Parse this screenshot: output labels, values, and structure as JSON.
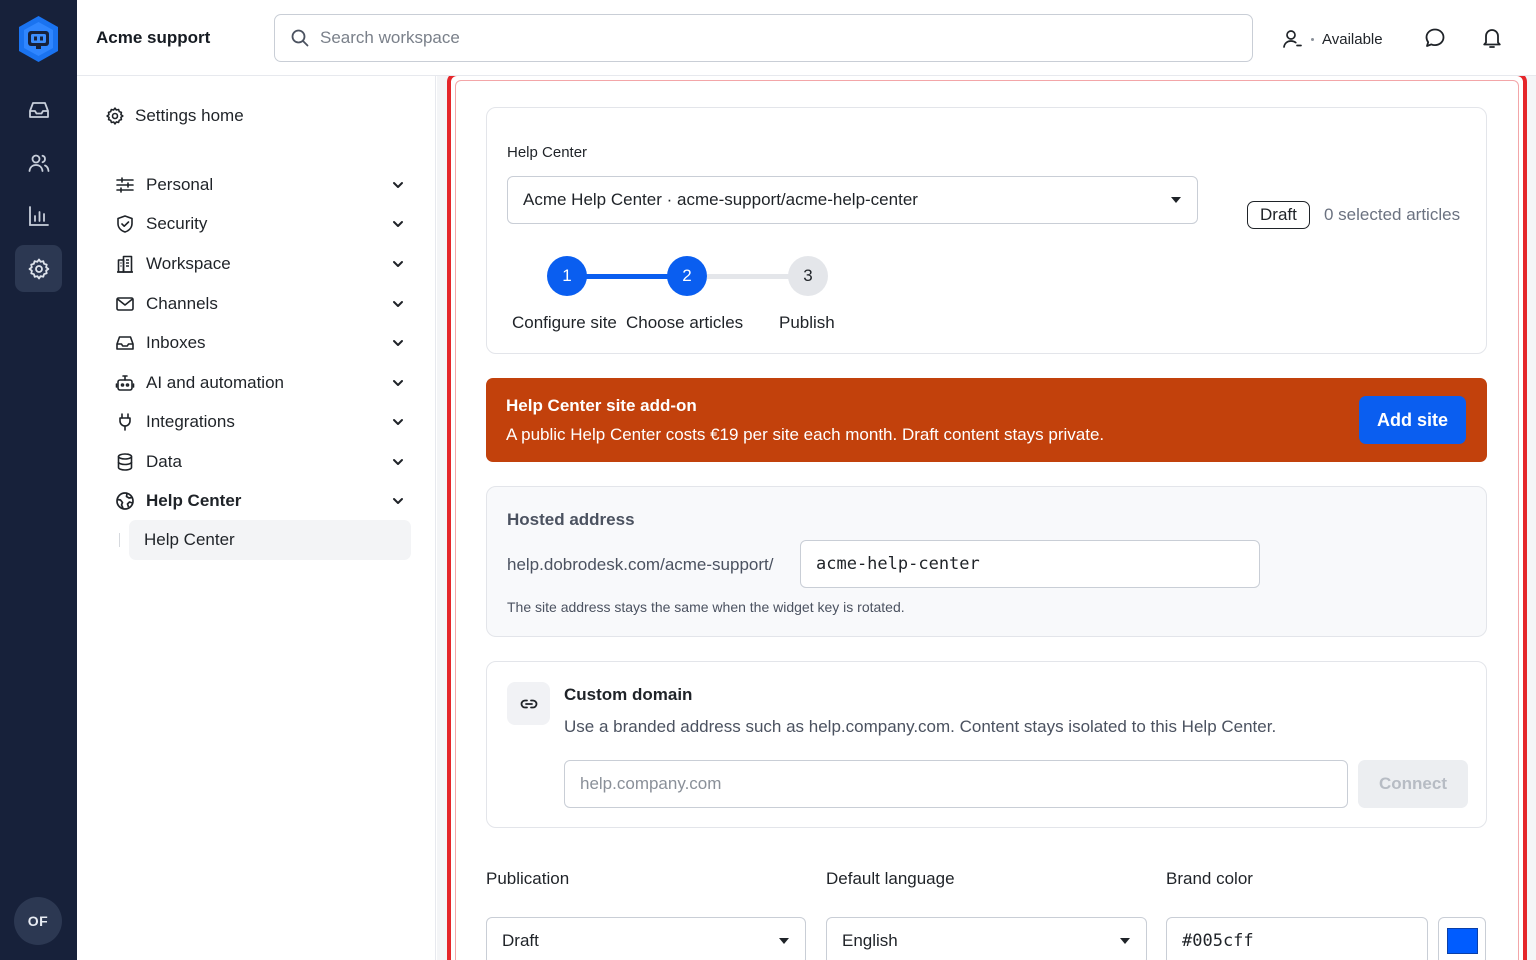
{
  "rail": {
    "avatar_initials": "OF",
    "items": [
      "inbox-icon",
      "contacts-icon",
      "reports-icon",
      "settings-icon"
    ],
    "active": "settings-icon"
  },
  "topbar": {
    "workspace": "Acme support",
    "search_placeholder": "Search workspace",
    "presence": "Available"
  },
  "sidebar": {
    "settings_home": "Settings home",
    "items": [
      {
        "label": "Personal",
        "icon": "sliders-icon"
      },
      {
        "label": "Security",
        "icon": "shield-icon"
      },
      {
        "label": "Workspace",
        "icon": "building-icon"
      },
      {
        "label": "Channels",
        "icon": "mail-icon"
      },
      {
        "label": "Inboxes",
        "icon": "inbox-icon"
      },
      {
        "label": "AI and automation",
        "icon": "robot-icon"
      },
      {
        "label": "Integrations",
        "icon": "plug-icon"
      },
      {
        "label": "Data",
        "icon": "database-icon"
      },
      {
        "label": "Help Center",
        "icon": "globe-icon"
      }
    ],
    "sub_item": "Help Center"
  },
  "help_center": {
    "label": "Help Center",
    "selected_site": "Acme Help Center · acme-support/acme-help-center",
    "status_badge": "Draft",
    "selected_articles": "0 selected articles",
    "steps": [
      {
        "number": "1",
        "label": "Configure site"
      },
      {
        "number": "2",
        "label": "Choose articles"
      },
      {
        "number": "3",
        "label": "Publish"
      }
    ],
    "current_step": 2
  },
  "banner": {
    "title": "Help Center site add-on",
    "text": "A public Help Center costs €19 per site each month. Draft content stays private.",
    "button": "Add site",
    "color": "#c2410c"
  },
  "hosted": {
    "title": "Hosted address",
    "prefix": "help.dobrodesk.com/acme-support/",
    "slug": "acme-help-center",
    "hint": "The site address stays the same when the widget key is rotated."
  },
  "custom_domain": {
    "title": "Custom domain",
    "description": "Use a branded address such as help.company.com. Content stays isolated to this Help Center.",
    "placeholder": "help.company.com",
    "button": "Connect"
  },
  "fields": {
    "publication_label": "Publication",
    "publication_value": "Draft",
    "language_label": "Default language",
    "language_value": "English",
    "brand_label": "Brand color",
    "brand_value": "#005cff"
  },
  "colors": {
    "accent": "#0a5ef0",
    "rail": "#17213a",
    "focus_outline": "#e5262a"
  }
}
